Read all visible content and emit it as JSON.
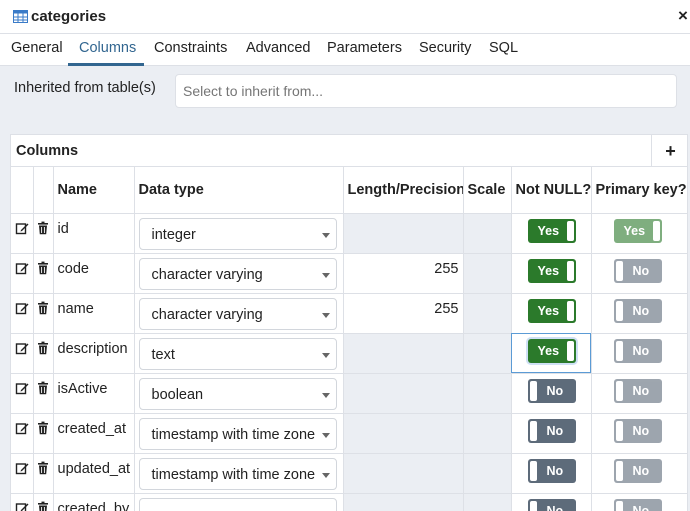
{
  "window": {
    "title": "categories",
    "title_icon": "table-icon",
    "close_glyph": "×"
  },
  "tabs": [
    "General",
    "Columns",
    "Constraints",
    "Advanced",
    "Parameters",
    "Security",
    "SQL"
  ],
  "active_tab": "Columns",
  "inherit": {
    "label": "Inherited from table(s)",
    "placeholder": "Select to inherit from..."
  },
  "grid": {
    "title": "Columns",
    "add_label": "+",
    "headers": {
      "name": "Name",
      "data_type": "Data type",
      "length": "Length/Precision",
      "scale": "Scale",
      "not_null": "Not NULL?",
      "primary_key": "Primary key?"
    },
    "rows": [
      {
        "name": "id",
        "data_type": "integer",
        "length": "",
        "scale": "",
        "not_null": "Yes",
        "primary_key": "Yes"
      },
      {
        "name": "code",
        "data_type": "character varying",
        "length": "255",
        "scale": "",
        "not_null": "Yes",
        "primary_key": "No"
      },
      {
        "name": "name",
        "data_type": "character varying",
        "length": "255",
        "scale": "",
        "not_null": "Yes",
        "primary_key": "No"
      },
      {
        "name": "description",
        "data_type": "text",
        "length": "",
        "scale": "",
        "not_null": "Yes",
        "primary_key": "No"
      },
      {
        "name": "isActive",
        "data_type": "boolean",
        "length": "",
        "scale": "",
        "not_null": "No",
        "primary_key": "No"
      },
      {
        "name": "created_at",
        "data_type": "timestamp with time zone",
        "length": "",
        "scale": "",
        "not_null": "No",
        "primary_key": "No"
      },
      {
        "name": "updated_at",
        "data_type": "timestamp with time zone",
        "length": "",
        "scale": "",
        "not_null": "No",
        "primary_key": "No"
      },
      {
        "name": "created_by",
        "data_type": "",
        "length": "",
        "scale": "",
        "not_null": "No",
        "primary_key": "No"
      }
    ]
  },
  "colors": {
    "accent": "#326690",
    "toggle_yes": "#2b7a2b",
    "toggle_no": "#5d6b7a",
    "panel_bg": "#ebeef3",
    "border": "#dde0e6"
  }
}
